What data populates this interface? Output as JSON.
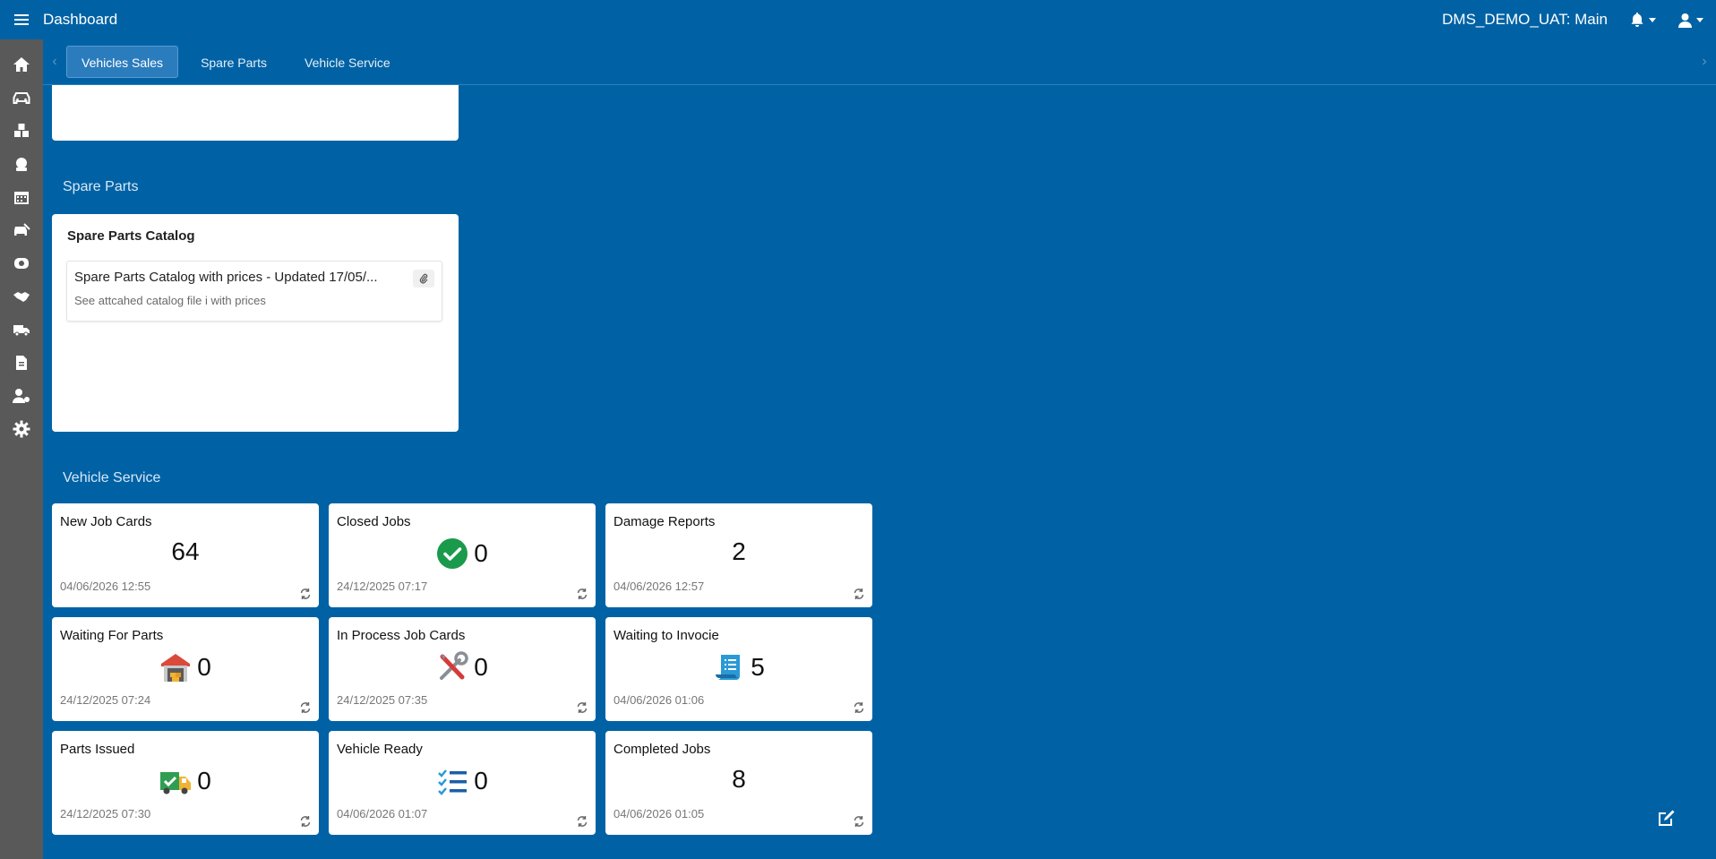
{
  "topbar": {
    "title": "Dashboard",
    "environment": "DMS_DEMO_UAT: Main"
  },
  "sidebar": {
    "items": [
      {
        "name": "home-icon"
      },
      {
        "name": "car-icon"
      },
      {
        "name": "parts-icon"
      },
      {
        "name": "service-icon"
      },
      {
        "name": "calendar-icon"
      },
      {
        "name": "car-repair-icon"
      },
      {
        "name": "tire-icon"
      },
      {
        "name": "handshake-icon"
      },
      {
        "name": "fleet-icon"
      },
      {
        "name": "document-icon"
      },
      {
        "name": "user-settings-icon"
      },
      {
        "name": "gear-icon"
      }
    ]
  },
  "tabs": [
    {
      "label": "Vehicles Sales",
      "active": true
    },
    {
      "label": "Spare Parts",
      "active": false
    },
    {
      "label": "Vehicle Service",
      "active": false
    }
  ],
  "spare_parts": {
    "section_title": "Spare Parts",
    "catalog": {
      "title": "Spare Parts Catalog",
      "item_title": "Spare Parts Catalog with prices - Updated 17/05/...",
      "item_desc": "See attcahed catalog file i with prices"
    }
  },
  "vehicle_service": {
    "section_title": "Vehicle Service",
    "kpis": [
      {
        "title": "New Job Cards",
        "value": "64",
        "date": "04/06/2026 12:55",
        "icon": ""
      },
      {
        "title": "Closed Jobs",
        "value": "0",
        "date": "24/12/2025 07:17",
        "icon": "check-circle-icon"
      },
      {
        "title": "Damage Reports",
        "value": "2",
        "date": "04/06/2026 12:57",
        "icon": ""
      },
      {
        "title": "Waiting For Parts",
        "value": "0",
        "date": "24/12/2025 07:24",
        "icon": "warehouse-icon"
      },
      {
        "title": "In Process Job Cards",
        "value": "0",
        "date": "24/12/2025 07:35",
        "icon": "tools-icon"
      },
      {
        "title": "Waiting to Invocie",
        "value": "5",
        "date": "04/06/2026 01:06",
        "icon": "invoice-icon"
      },
      {
        "title": "Parts Issued",
        "value": "0",
        "date": "24/12/2025 07:30",
        "icon": "delivery-truck-icon"
      },
      {
        "title": "Vehicle Ready",
        "value": "0",
        "date": "04/06/2026 01:07",
        "icon": "checklist-icon"
      },
      {
        "title": "Completed Jobs",
        "value": "8",
        "date": "04/06/2026 01:05",
        "icon": ""
      }
    ]
  },
  "colors": {
    "background": "#0062a5",
    "sidebar": "#595959",
    "active_tab": "#2b7cbd"
  }
}
